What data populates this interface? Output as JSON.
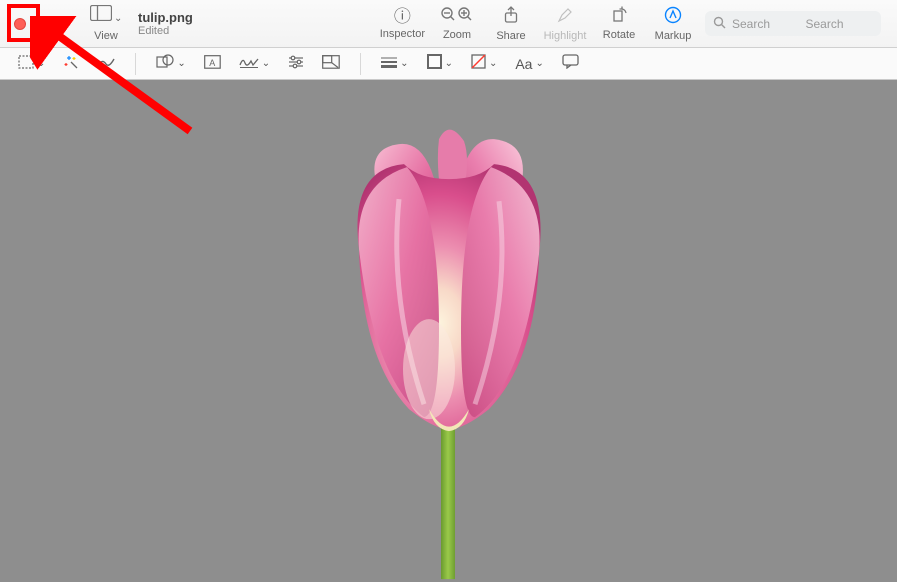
{
  "titlebar": {
    "view_label": "View",
    "filename": "tulip.png",
    "status": "Edited",
    "tools": {
      "inspector": "Inspector",
      "zoom": "Zoom",
      "share": "Share",
      "highlight": "Highlight",
      "rotate": "Rotate",
      "markup": "Markup"
    },
    "search_placeholder": "Search",
    "search_label": "Search"
  },
  "toolbar2": {
    "text_style": "Aa"
  },
  "annotation": {
    "target": "close-window-button"
  }
}
